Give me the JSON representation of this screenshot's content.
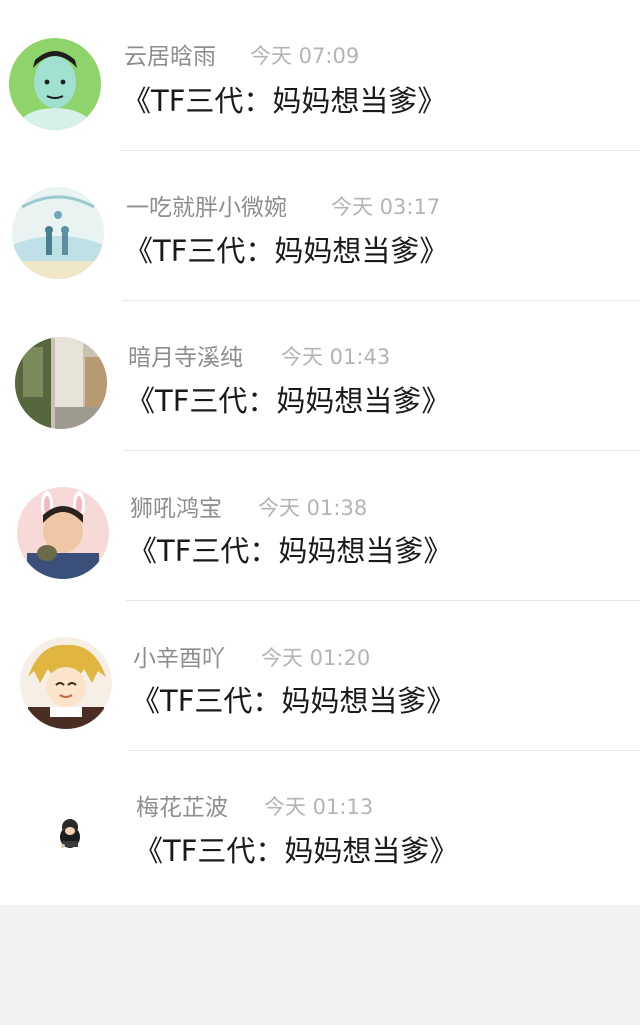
{
  "messages": [
    {
      "name": "云居晗雨",
      "time": "今天 07:09",
      "text": "《TF三代：妈妈想当爹》",
      "avatar": "avatar-cartoon-man-green"
    },
    {
      "name": "一吃就胖小微婉",
      "time": "今天 03:17",
      "text": "《TF三代：妈妈想当爹》",
      "avatar": "avatar-couple-watercolor"
    },
    {
      "name": "暗月寺溪纯",
      "time": "今天 01:43",
      "text": "《TF三代：妈妈想当爹》",
      "avatar": "avatar-street-photo"
    },
    {
      "name": "狮吼鸿宝",
      "time": "今天 01:38",
      "text": "《TF三代：妈妈想当爹》",
      "avatar": "avatar-boy-bunny-ears"
    },
    {
      "name": "小辛酉吖",
      "time": "今天 01:20",
      "text": "《TF三代：妈妈想当爹》",
      "avatar": "avatar-anime-character"
    },
    {
      "name": "梅花芷波",
      "time": "今天 01:13",
      "text": "《TF三代：妈妈想当爹》",
      "avatar": "avatar-small-doll"
    }
  ],
  "colors": {
    "name": "#8e8e8e",
    "time": "#b4b4b4",
    "text": "#1a1a1a",
    "background": "#f2f2f2",
    "card": "#ffffff"
  }
}
